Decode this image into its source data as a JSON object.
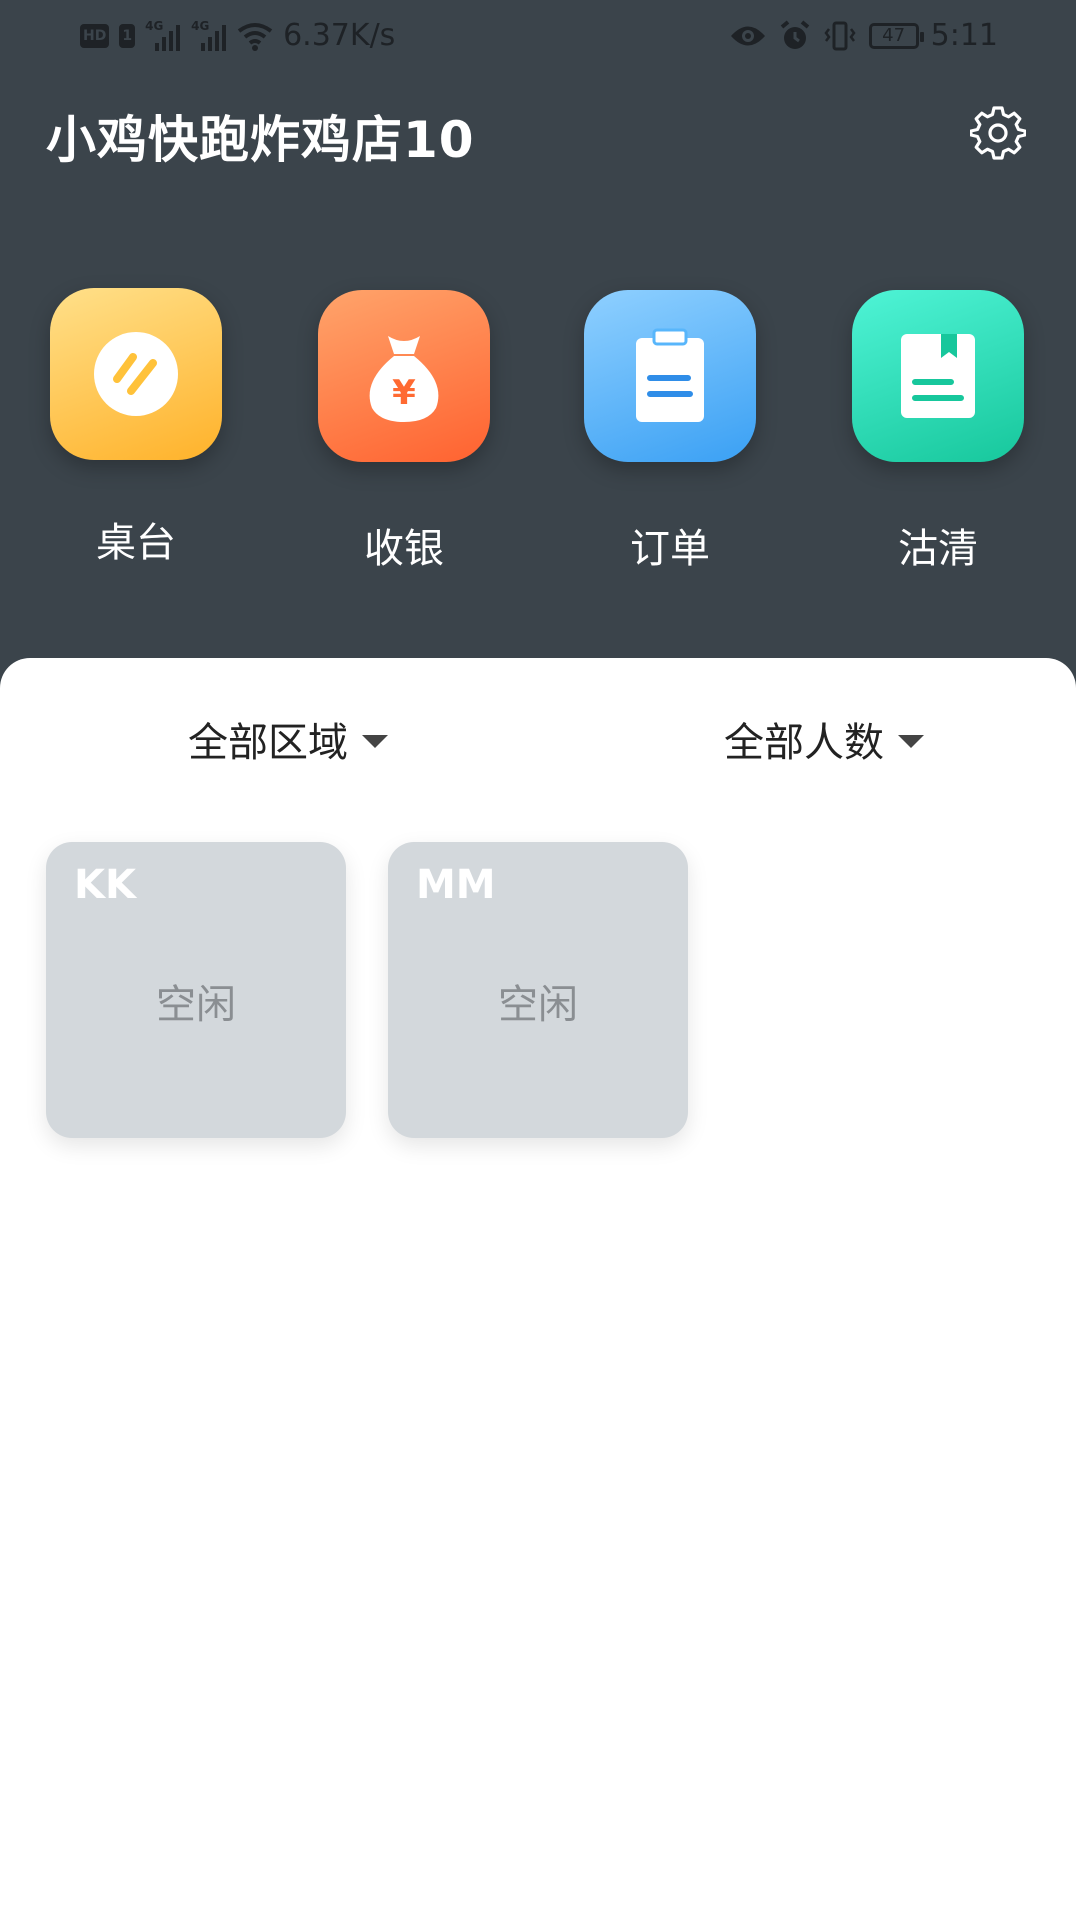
{
  "status_bar": {
    "left_badges": [
      "HD",
      "1"
    ],
    "network_label": "4G",
    "speed": "6.37K/s",
    "battery": "47",
    "time": "5:11"
  },
  "header": {
    "title": "小鸡快跑炸鸡店10"
  },
  "tiles": [
    {
      "label": "桌台",
      "icon": "table-icon",
      "color": "#ffb22a"
    },
    {
      "label": "收银",
      "icon": "money-bag-icon",
      "color": "#ff6230"
    },
    {
      "label": "订单",
      "icon": "clipboard-icon",
      "color": "#3aa0f4"
    },
    {
      "label": "沽清",
      "icon": "notebook-icon",
      "color": "#17c79c"
    }
  ],
  "filters": {
    "area": "全部区域",
    "people": "全部人数"
  },
  "tables": [
    {
      "name": "KK",
      "status": "空闲"
    },
    {
      "name": "MM",
      "status": "空闲"
    }
  ],
  "colors": {
    "header_bg": "#3b444b",
    "card_bg": "#d3d8dc"
  }
}
